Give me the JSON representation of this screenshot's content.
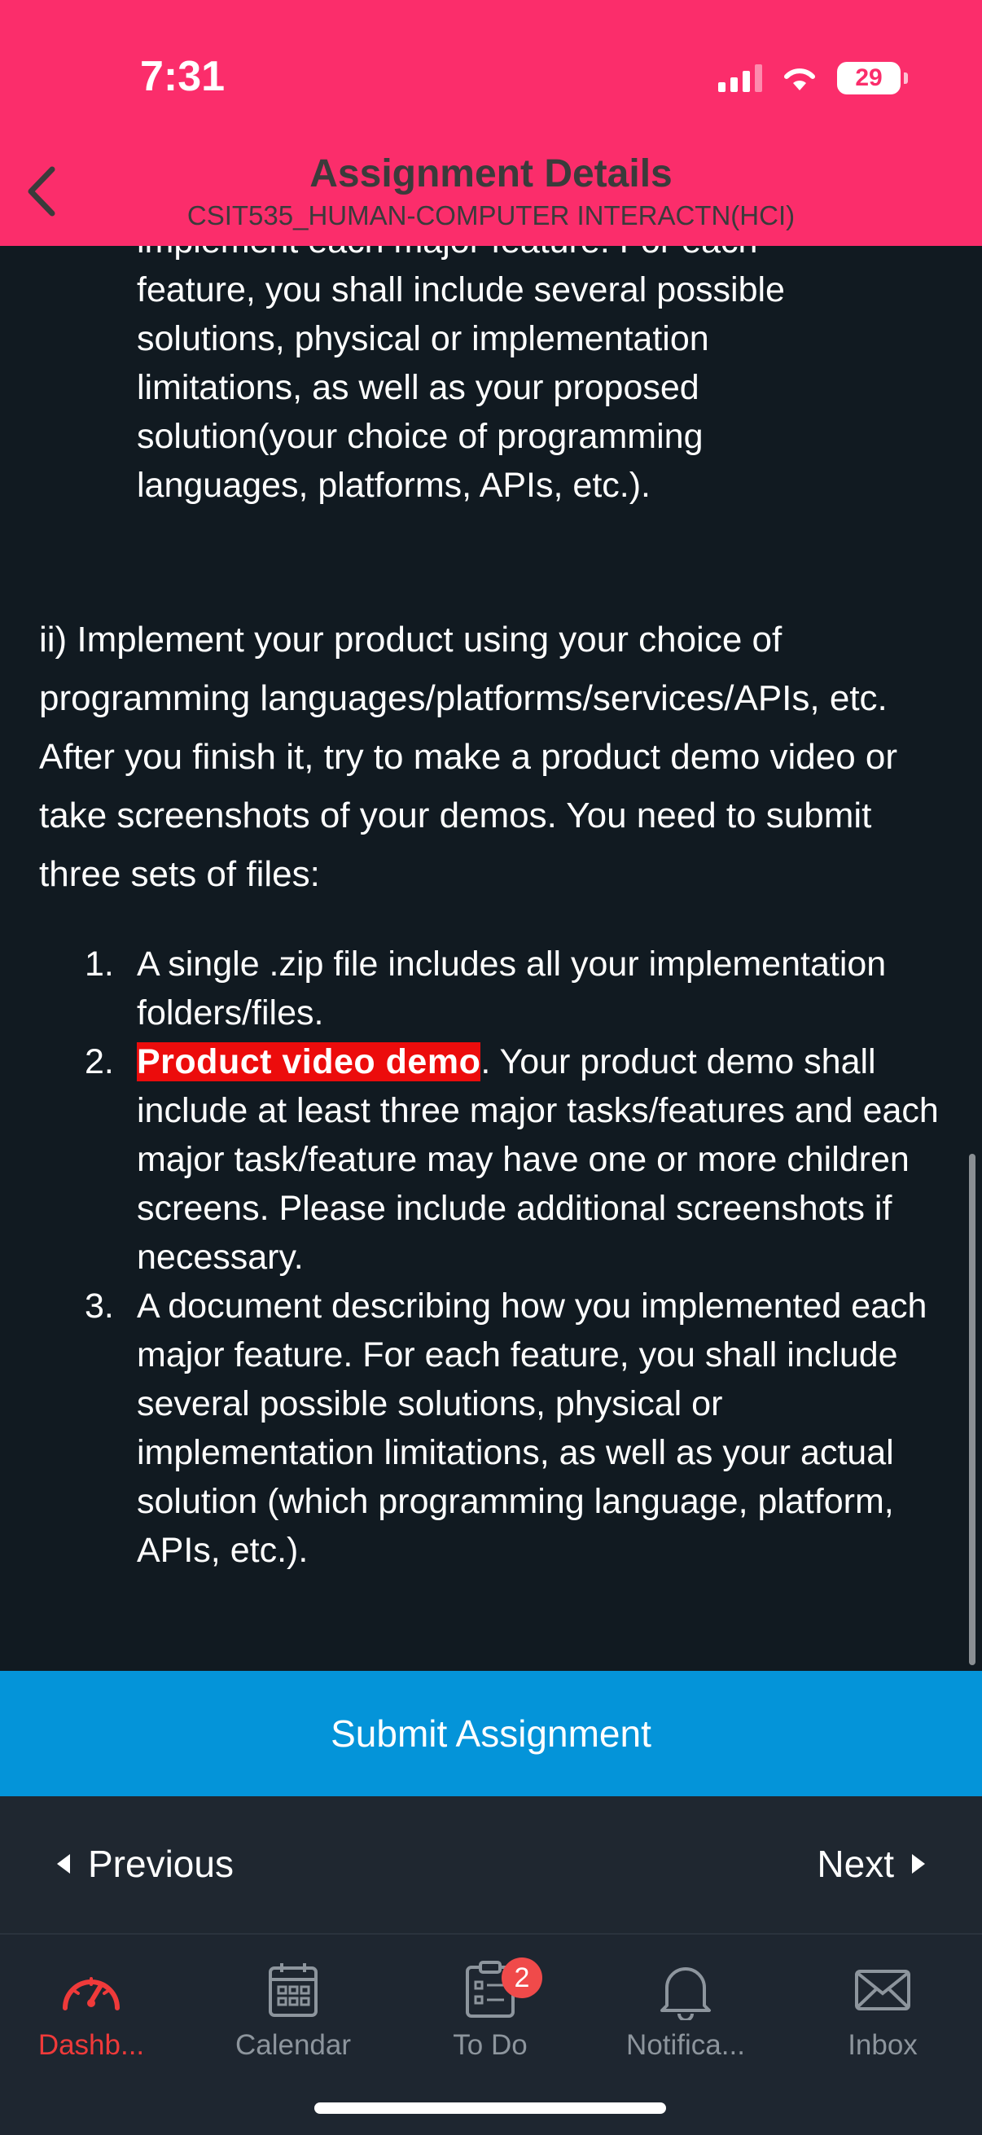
{
  "status": {
    "time": "7:31",
    "battery": "29"
  },
  "header": {
    "title": "Assignment Details",
    "subtitle": "CSIT535_HUMAN-COMPUTER INTERACTN(HCI)"
  },
  "content": {
    "partial_top_line": "implement each major feature. For each",
    "top_list_lines": [
      "feature, you shall include several possible",
      "solutions, physical or implementation",
      "limitations, as well as your proposed",
      "solution(your choice of programming",
      "languages, platforms, APIs, etc.)."
    ],
    "paragraph": "ii) Implement your product using your choice of programming languages/platforms/services/APIs, etc. After you finish it, try to make a product demo video or take screenshots of your demos. You need to submit three sets of files:",
    "list": [
      {
        "number": "1.",
        "text": "A single .zip file includes all your implementation folders/files."
      },
      {
        "number": "2.",
        "highlight": "Product video demo",
        "text": ". Your product demo shall include at least three major tasks/features and each major task/feature may have one or more children screens.   Please include additional screenshots if necessary."
      },
      {
        "number": "3.",
        "text": "A document describing how you implemented each major feature. For each feature, you shall include several possible solutions, physical or implementation limitations, as well as your actual solution (which programming language, platform, APIs, etc.)."
      }
    ]
  },
  "actions": {
    "submit": "Submit Assignment"
  },
  "pager": {
    "previous": "Previous",
    "next": "Next"
  },
  "tabs": [
    {
      "label": "Dashb...",
      "icon": "dashboard-icon"
    },
    {
      "label": "Calendar",
      "icon": "calendar-icon"
    },
    {
      "label": "To Do",
      "icon": "todo-icon",
      "badge": "2"
    },
    {
      "label": "Notifica...",
      "icon": "bell-icon"
    },
    {
      "label": "Inbox",
      "icon": "mail-icon"
    }
  ],
  "colors": {
    "header": "#fb2d6b",
    "background": "#111a21",
    "submit": "#0494d9",
    "highlight": "#ec0c0c",
    "active_tab": "#ef3a3a"
  }
}
